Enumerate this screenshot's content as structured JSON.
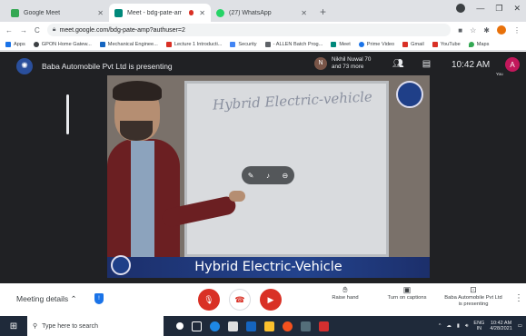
{
  "browser": {
    "tabs": [
      {
        "title": "Google Meet",
        "fav_color": "#34a853",
        "active": false
      },
      {
        "title": "Meet - bdg-pate-amp",
        "fav_color": "#00897b",
        "active": true,
        "recording": true
      },
      {
        "title": "(27) WhatsApp",
        "fav_color": "#25d366",
        "active": false
      }
    ],
    "url": "meet.google.com/bdg-pate-amp?authuser=2",
    "bookmarks": [
      {
        "label": "Apps",
        "color": "#1a73e8"
      },
      {
        "label": "GPON Home Gatew...",
        "color": "#3c4043"
      },
      {
        "label": "Mechanical Enginee...",
        "color": "#1565c0"
      },
      {
        "label": "Lecture 1 Introducti...",
        "color": "#d93025"
      },
      {
        "label": "Security",
        "color": "#4285f4"
      },
      {
        "label": "- ALLEN Batch Prog...",
        "color": "#5f6368"
      },
      {
        "label": "Meet",
        "color": "#00897b"
      },
      {
        "label": "Prime Video",
        "color": "#1a73e8"
      },
      {
        "label": "Gmail",
        "color": "#d93025"
      },
      {
        "label": "YouTube",
        "color": "#d93025"
      },
      {
        "label": "Maps",
        "color": "#34a853"
      }
    ]
  },
  "meet": {
    "presenting_text": "Baba Automobile Pvt Ltd is presenting",
    "participant_initial": "N",
    "participant_name": "Nikhil Nuwal 70",
    "participant_more": "and 73 more",
    "time": "10:42 AM",
    "self_initial": "A",
    "self_label": "You",
    "board_title": "Hybrid Electric-vehicle",
    "caption": "Hybrid Electric-Vehicle"
  },
  "controls": {
    "meeting_details": "Meeting details",
    "raise_hand": "Raise hand",
    "captions": "Turn on captions",
    "presenting_line1": "Baba Automobile Pvt Ltd",
    "presenting_line2": "is presenting"
  },
  "taskbar": {
    "search_placeholder": "Type here to search",
    "lang": "ENG",
    "region": "IN",
    "time": "10:42 AM",
    "date": "4/28/2021"
  }
}
